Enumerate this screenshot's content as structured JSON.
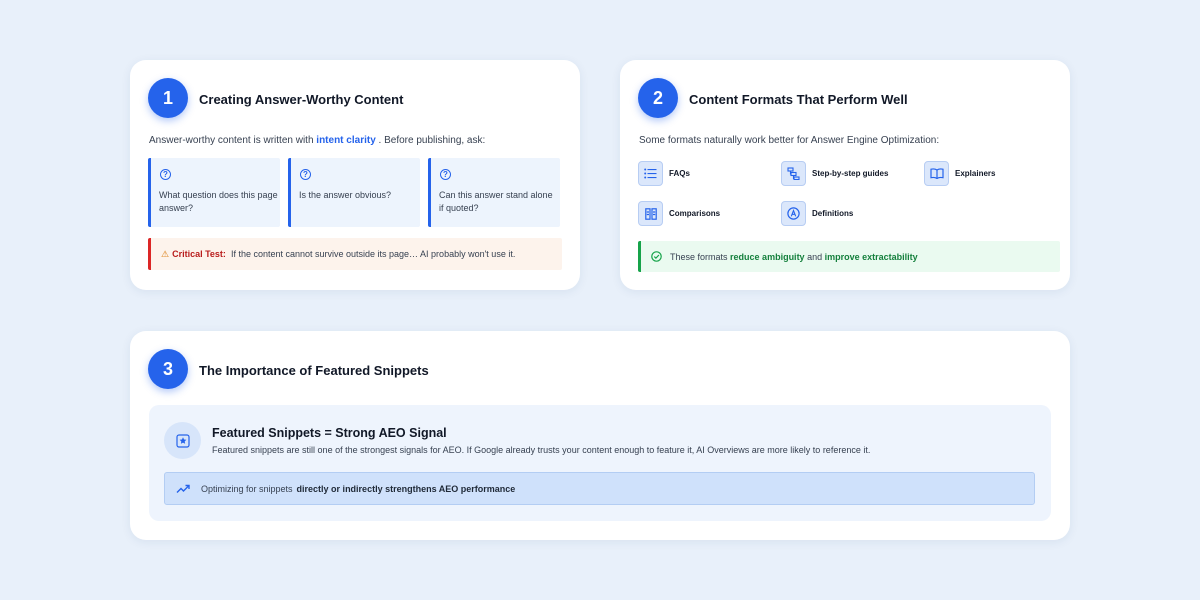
{
  "colors": {
    "accent": "#2563eb",
    "critical": "#dc2626",
    "success": "#16a34a",
    "background": "#e8f0fa"
  },
  "section1": {
    "number": "1",
    "title": "Creating Answer-Worthy Content",
    "intro_before": "Answer-worthy content is written with",
    "intro_highlight": "intent clarity",
    "intro_after": ". Before publishing, ask:",
    "questions": [
      {
        "icon": "question-circle-icon",
        "text": "What question does this page answer?"
      },
      {
        "icon": "question-circle-icon",
        "text": "Is the answer obvious?"
      },
      {
        "icon": "question-circle-icon",
        "text": "Can this answer stand alone if quoted?"
      }
    ],
    "critical": {
      "icon": "warning-icon",
      "label": "Critical Test:",
      "text": "If the content cannot survive outside its page… AI probably won't use it."
    }
  },
  "section2": {
    "number": "2",
    "title": "Content Formats That Perform Well",
    "intro": "Some formats naturally work better for Answer Engine Optimization:",
    "formats": [
      {
        "icon": "list-icon",
        "label": "FAQs"
      },
      {
        "icon": "steps-icon",
        "label": "Step-by-step guides"
      },
      {
        "icon": "book-icon",
        "label": "Explainers"
      },
      {
        "icon": "compare-icon",
        "label": "Comparisons"
      },
      {
        "icon": "definition-icon",
        "label": "Definitions"
      }
    ],
    "note": {
      "icon": "check-circle-icon",
      "before": "These formats",
      "highlight1": "reduce ambiguity",
      "middle": "and",
      "highlight2": "improve extractability"
    }
  },
  "section3": {
    "number": "3",
    "title": "The Importance of Featured Snippets",
    "panel": {
      "icon": "star-icon",
      "heading": "Featured Snippets = Strong AEO Signal",
      "description": "Featured snippets are still one of the strongest signals for AEO. If Google already trusts your content enough to feature it, AI Overviews are more likely to reference it.",
      "callout": {
        "icon": "trend-up-icon",
        "before": "Optimizing for snippets",
        "strong": "directly or indirectly strengthens AEO performance"
      }
    }
  }
}
